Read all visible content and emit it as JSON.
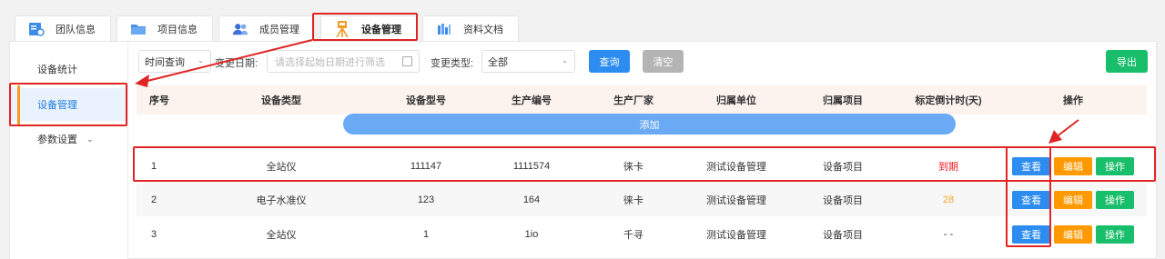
{
  "tabs": [
    {
      "label": "团队信息",
      "icon": "team-info-icon",
      "active": false
    },
    {
      "label": "项目信息",
      "icon": "folder-icon",
      "active": false
    },
    {
      "label": "成员管理",
      "icon": "members-icon",
      "active": false
    },
    {
      "label": "设备管理",
      "icon": "device-icon",
      "active": true
    },
    {
      "label": "资料文档",
      "icon": "documents-icon",
      "active": false
    }
  ],
  "sidebar": {
    "items": [
      {
        "label": "设备统计",
        "active": false
      },
      {
        "label": "设备管理",
        "active": true
      },
      {
        "label": "参数设置",
        "active": false,
        "has_submenu": true
      }
    ]
  },
  "toolbar": {
    "time_filter": "时间查询",
    "change_date_label": "变更日期:",
    "date_placeholder": "请选择起始日期进行筛选",
    "change_type_label": "变更类型:",
    "change_type_value": "全部",
    "query_label": "查询",
    "clear_label": "清空",
    "export_label": "导出"
  },
  "table": {
    "headers": [
      "序号",
      "设备类型",
      "设备型号",
      "生产编号",
      "生产厂家",
      "归属单位",
      "归属项目",
      "标定倒计时(天)",
      "操作"
    ],
    "add_label": "添加",
    "rows": [
      {
        "no": "1",
        "type": "全站仪",
        "model": "111147",
        "serial": "1111574",
        "maker": "徕卡",
        "unit": "测试设备管理",
        "project": "设备项目",
        "countdown": "到期",
        "countdown_status": "expired"
      },
      {
        "no": "2",
        "type": "电子水准仪",
        "model": "123",
        "serial": "164",
        "maker": "徕卡",
        "unit": "测试设备管理",
        "project": "设备项目",
        "countdown": "28",
        "countdown_status": "warning"
      },
      {
        "no": "3",
        "type": "全站仪",
        "model": "1",
        "serial": "1io",
        "maker": "千寻",
        "unit": "测试设备管理",
        "project": "设备项目",
        "countdown": "- -",
        "countdown_status": "none"
      }
    ],
    "actions": {
      "view": "查看",
      "edit": "编辑",
      "operate": "操作"
    }
  },
  "colors": {
    "primary": "#2d8cf0",
    "warning": "#ff9900",
    "success": "#19be6b",
    "danger": "#ed1c24",
    "highlight": "#e02424"
  }
}
